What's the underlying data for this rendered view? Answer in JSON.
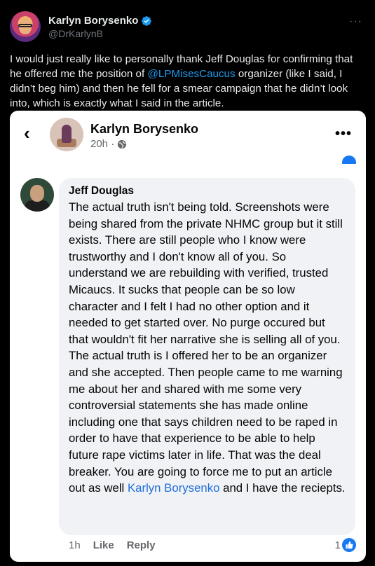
{
  "tweet": {
    "display_name": "Karlyn Borysenko",
    "handle": "@DrKarlynB",
    "text_before": "I would just really like to personally thank Jeff Douglas for confirming that he offered me the position of ",
    "mention": "@LPMisesCaucus",
    "text_after": " organizer (like I said, I didn’t beg him) and then he fell for a smear campaign that he didn’t look into, which is exactly what I said in the article.",
    "more_icon": "ellipsis-icon",
    "verified_color": "#1d9bf0"
  },
  "screenshot": {
    "post_author": "Karlyn Borysenko",
    "post_time": "20h ·",
    "comment": {
      "author": "Jeff Douglas",
      "text_before": "The actual truth isn't being told. Screenshots were being shared from the private NHMC group but it still exists. There are still people who I know were trustworthy and I don't know all of you. So understand we are rebuilding with verified, trusted Micaucs. It sucks that people can be so low character and I felt I had no other option and it needed to get started over. No purge occured but that wouldn't fit her narrative she is selling all of you. The actual truth is I offered her to be an organizer and she accepted. Then people came to me warning me about her and shared with me some very controversial statements she has made online including one that says children need to be raped in order to have that experience to be able to help future rape victims later in life. That was the deal breaker. You are going to force me to put an article out as well ",
      "mention": "Karlyn Borysenko",
      "text_after": " and I have the reciepts.",
      "time": "1h",
      "like_label": "Like",
      "reply_label": "Reply",
      "reaction_count": "1"
    },
    "accent_color": "#1877f2"
  }
}
